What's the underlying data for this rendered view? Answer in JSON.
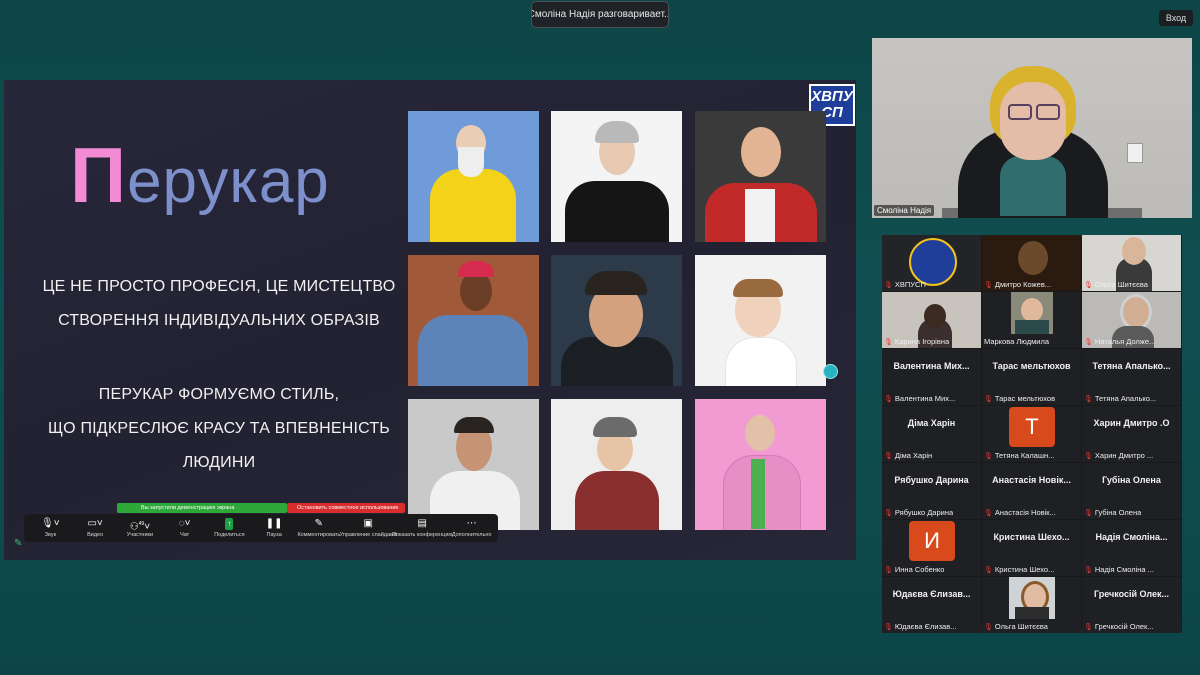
{
  "top": {
    "talking_banner": "Смоліна Надія разговаривает...",
    "exit_button": "Вход"
  },
  "slide": {
    "title_first": "П",
    "title_rest": "ерукар",
    "line1": "ЦЕ НЕ ПРОСТО ПРОФЕСІЯ, ЦЕ МИСТЕЦТВО",
    "line2": "СТВОРЕННЯ ІНДИВІДУАЛЬНИХ ОБРАЗІВ",
    "line3": "ПЕРУКАР ФОРМУЄМО СТИЛЬ,",
    "line4": "ЩО ПІДКРЕСЛЮЄ КРАСУ ТА ВПЕВНЕНІСТЬ",
    "line5": "ЛЮДИНИ",
    "logo_top": "ХВПУ",
    "logo_bottom": "СП"
  },
  "share": {
    "green_text": "Вы запустили демонстрацию экрана",
    "red_text": "Остановить совместное использование"
  },
  "toolbar": {
    "items": [
      {
        "label": "Звук",
        "icon": "mic-icon"
      },
      {
        "label": "Видео",
        "icon": "camera-icon"
      },
      {
        "label": "Участники",
        "icon": "participants-icon",
        "badge": "49"
      },
      {
        "label": "Чат",
        "icon": "chat-icon"
      },
      {
        "label": "Поделиться",
        "icon": "share-icon"
      },
      {
        "label": "Пауза",
        "icon": "pause-icon"
      },
      {
        "label": "Комментировать",
        "icon": "annotate-icon"
      },
      {
        "label": "Управление слайдами",
        "icon": "slides-icon"
      },
      {
        "label": "Показать конференцию",
        "icon": "show-meeting-icon"
      },
      {
        "label": "Дополнительно",
        "icon": "more-icon"
      }
    ]
  },
  "speaker": {
    "name": "Смоліна Надія"
  },
  "gallery": {
    "tiles": [
      {
        "label": "ХВПУСП",
        "big": "",
        "type": "logo"
      },
      {
        "label": "Дмитро Кожев...",
        "big": "",
        "type": "video-dark"
      },
      {
        "label": "Ольга Шитєєва",
        "big": "",
        "type": "video-light"
      },
      {
        "label": "Карина Ігорівна",
        "big": "",
        "type": "video-light"
      },
      {
        "label": "Маркова Людмила",
        "big": "",
        "type": "video-mid"
      },
      {
        "label": "Наталья Долже...",
        "big": "",
        "type": "video-light"
      },
      {
        "label": "Валентина Мих...",
        "big": "Валентина  Мих...",
        "type": "name"
      },
      {
        "label": "Тарас мельтюхов",
        "big": "Тарас мельтюхов",
        "type": "name"
      },
      {
        "label": "Тетяна Апалько...",
        "big": "Тетяна  Апалько...",
        "type": "name"
      },
      {
        "label": "Діма Харін",
        "big": "Діма Харін",
        "type": "name"
      },
      {
        "label": "Тетяна Калашн...",
        "big": "Т",
        "type": "letter"
      },
      {
        "label": "Харин Дмитро ...",
        "big": "Харин Дмитро .О",
        "type": "name"
      },
      {
        "label": "Рябушко Дарина",
        "big": "Рябушко Дарина",
        "type": "name"
      },
      {
        "label": "Анастасія Новік...",
        "big": "Анастасія Новік...",
        "type": "name"
      },
      {
        "label": "Губіна Олена",
        "big": "Губіна Олена",
        "type": "name"
      },
      {
        "label": "Инна Собенко",
        "big": "И",
        "type": "letter"
      },
      {
        "label": "Кристина Шехо...",
        "big": "Кристина  Шехо...",
        "type": "name"
      },
      {
        "label": "Надія Смоліна ...",
        "big": "Надія Смоліна...",
        "type": "name"
      },
      {
        "label": "Юдаєва Єлизав...",
        "big": "Юдаєва Єлизав...",
        "type": "name"
      },
      {
        "label": "Ольга Шитєєва",
        "big": "",
        "type": "video-light"
      },
      {
        "label": "Гречкосій Олек...",
        "big": "Гречкосій  Олек...",
        "type": "name"
      }
    ]
  },
  "colors": {
    "background": "#0f4f51",
    "title_pink": "#f28bd3",
    "title_blue": "#7d90cb",
    "share_green": "#2fa83a",
    "share_red": "#d92d2d",
    "avatar_orange": "#d84a1b",
    "mic_off_red": "#e53935"
  }
}
